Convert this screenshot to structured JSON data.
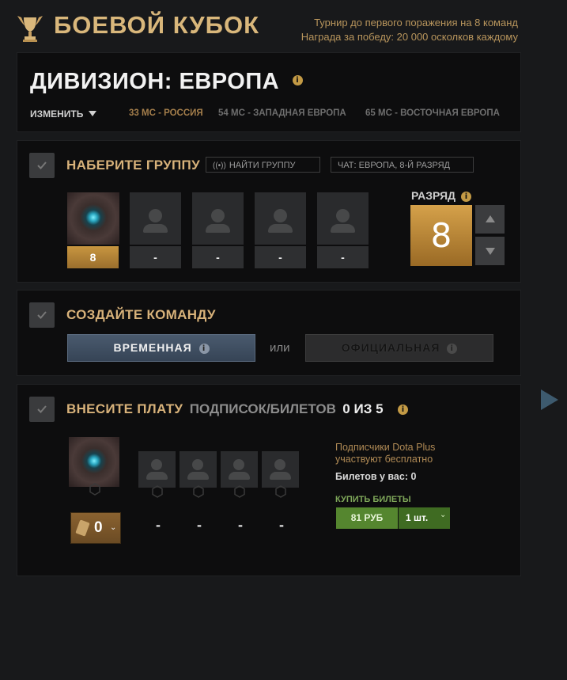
{
  "header": {
    "title": "БОЕВОЙ КУБОК",
    "subtitle_line1": "Турнир до первого поражения на 8 команд",
    "subtitle_line2": "Награда за победу: 20 000 осколков каждому"
  },
  "division": {
    "title": "ДИВИЗИОН: ЕВРОПА",
    "change_label": "ИЗМЕНИТЬ",
    "servers": [
      "33 МС - РОССИЯ",
      "54 МС - ЗАПАДНАЯ ЕВРОПА",
      "65 МС - ВОСТОЧНАЯ ЕВРОПА"
    ]
  },
  "party": {
    "title": "НАБЕРИТЕ ГРУППУ",
    "find_group": "НАЙТИ ГРУППУ",
    "chat": "ЧАТ: ЕВРОПА, 8-Й РАЗРЯД",
    "slot_ranks": [
      "8",
      "-",
      "-",
      "-",
      "-"
    ],
    "rank_label": "РАЗРЯД",
    "rank_value": "8"
  },
  "team": {
    "title": "СОЗДАЙТЕ КОМАНДУ",
    "temporary": "ВРЕМЕННАЯ",
    "or": "или",
    "official": "ОФИЦИАЛЬНАЯ"
  },
  "payment": {
    "title": "ВНЕСИТЕ ПЛАТУ",
    "subtitle": "ПОДПИСОК/БИЛЕТОВ",
    "count": "0 ИЗ 5",
    "ticket_count": "0",
    "dashes": [
      "-",
      "-",
      "-",
      "-"
    ],
    "plus_note_line1": "Подписчики Dota Plus",
    "plus_note_line2": "участвуют бесплатно",
    "tickets_have": "Билетов у вас: 0",
    "buy_label": "КУПИТЬ БИЛЕТЫ",
    "price": "81 РУБ",
    "quantity": "1 шт."
  },
  "colors": {
    "gold": "#d9b77b",
    "accent": "#c89640",
    "buy_green": "#55862f",
    "background": "#18191b",
    "panel": "#0d0d0e"
  }
}
